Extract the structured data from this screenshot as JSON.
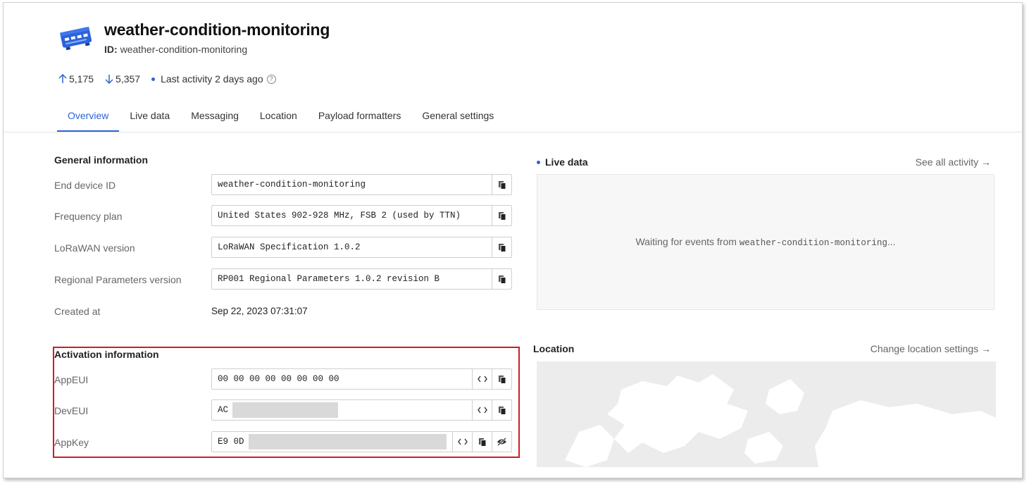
{
  "device": {
    "title": "weather-condition-monitoring",
    "id_label": "ID:",
    "id_value": "weather-condition-monitoring"
  },
  "stats": {
    "uplink": "5,175",
    "downlink": "5,357",
    "last_activity": "Last activity 2 days ago",
    "help_icon": "?"
  },
  "tabs": [
    {
      "label": "Overview",
      "active": true
    },
    {
      "label": "Live data"
    },
    {
      "label": "Messaging"
    },
    {
      "label": "Location"
    },
    {
      "label": "Payload formatters"
    },
    {
      "label": "General settings"
    }
  ],
  "general": {
    "title": "General information",
    "end_device_id_label": "End device ID",
    "end_device_id": "weather-condition-monitoring",
    "frequency_plan_label": "Frequency plan",
    "frequency_plan": "United States 902-928 MHz, FSB 2 (used by TTN)",
    "lorawan_version_label": "LoRaWAN version",
    "lorawan_version": "LoRaWAN Specification 1.0.2",
    "regional_params_label": "Regional Parameters version",
    "regional_params": "RP001 Regional Parameters 1.0.2 revision B",
    "created_at_label": "Created at",
    "created_at": "Sep 22, 2023 07:31:07"
  },
  "activation": {
    "title": "Activation information",
    "appeui_label": "AppEUI",
    "appeui": "00 00 00 00 00 00 00 00",
    "deveui_label": "DevEUI",
    "deveui_visible": "AC",
    "appkey_label": "AppKey",
    "appkey_visible": "E9 0D"
  },
  "live": {
    "title": "Live data",
    "see_all": "See all activity →",
    "waiting_prefix": "Waiting for events from ",
    "waiting_device": "weather-condition-monitoring",
    "waiting_suffix": "..."
  },
  "location": {
    "title": "Location",
    "change_link": "Change location settings →"
  },
  "colors": {
    "accent": "#2d63d8",
    "highlight_border": "#d01c24"
  },
  "icons": {
    "device": "device-icon",
    "copy": "copy-icon",
    "code": "code-icon",
    "hide": "eye-slash-icon",
    "uplink": "arrow-up-icon",
    "downlink": "arrow-down-icon"
  }
}
